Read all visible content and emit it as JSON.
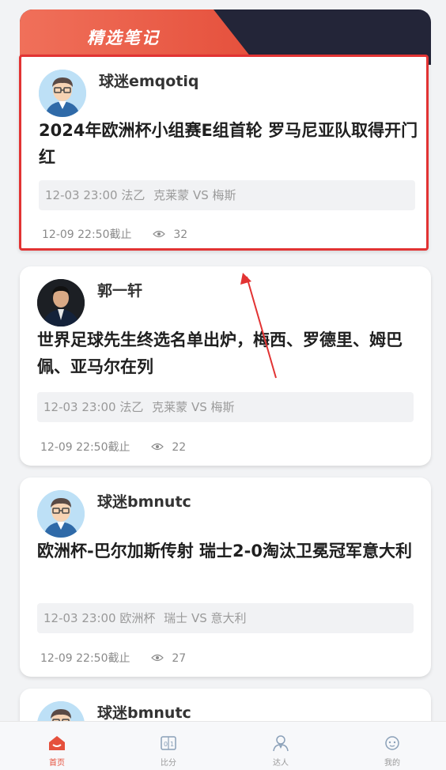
{
  "header": {
    "title": "精选笔记"
  },
  "colors": {
    "accent": "#e5503c",
    "header_dark": "#232538",
    "highlight_border": "#e23333"
  },
  "cards": [
    {
      "author": "球迷emqotiq",
      "avatar": "cartoon-avatar-icon",
      "title": "2024年欧洲杯小组赛E组首轮 罗马尼亚队取得开门红",
      "match_time": "12-03 23:00",
      "league": "法乙",
      "teams": "克莱蒙 VS 梅斯",
      "deadline": "12-09 22:50截止",
      "views": "32",
      "highlighted": true
    },
    {
      "author": "郭一轩",
      "avatar": "photo-avatar",
      "title": "世界足球先生终选名单出炉，梅西、罗德里、姆巴佩、亚马尔在列",
      "match_time": "12-03 23:00",
      "league": "法乙",
      "teams": "克莱蒙 VS 梅斯",
      "deadline": "12-09 22:50截止",
      "views": "22",
      "highlighted": false
    },
    {
      "author": "球迷bmnutc",
      "avatar": "cartoon-avatar-icon",
      "title": "欧洲杯-巴尔加斯传射 瑞士2-0淘汰卫冕冠军意大利",
      "match_time": "12-03 23:00",
      "league": "欧洲杯",
      "teams": "瑞士 VS 意大利",
      "deadline": "12-09 22:50截止",
      "views": "27",
      "highlighted": false
    },
    {
      "author": "球迷bmnutc",
      "avatar": "cartoon-avatar-icon",
      "highlighted": false
    }
  ],
  "tabbar": [
    {
      "label": "首页",
      "icon": "home-icon",
      "active": true
    },
    {
      "label": "比分",
      "icon": "scoreboard-icon",
      "active": false
    },
    {
      "label": "达人",
      "icon": "expert-icon",
      "active": false
    },
    {
      "label": "我的",
      "icon": "profile-icon",
      "active": false
    }
  ]
}
